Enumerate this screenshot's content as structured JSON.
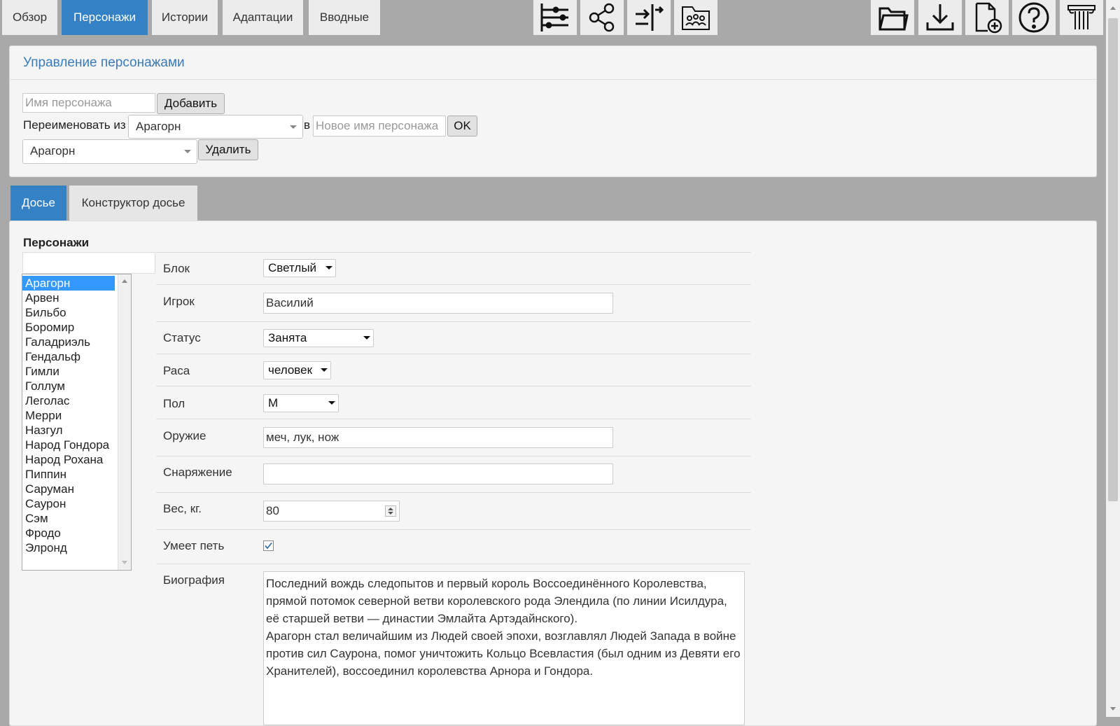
{
  "nav": {
    "tabs": [
      "Обзор",
      "Персонажи",
      "Истории",
      "Адаптации",
      "Вводные"
    ],
    "active_tab": "Персонажи",
    "icons": [
      "timeline-icon",
      "share-network-icon",
      "split-arrows-icon",
      "group-folder-icon",
      "open-folder-icon",
      "download-icon",
      "new-file-icon",
      "help-icon",
      "column-logo-icon"
    ]
  },
  "manage": {
    "title": "Управление персонажами",
    "name_placeholder": "Имя персонажа",
    "add_label": "Добавить",
    "rename_label": "Переименовать из",
    "rename_from": "Арагорн",
    "to_label": "в",
    "new_name_placeholder": "Новое имя персонажа",
    "ok_label": "OK",
    "delete_select": "Арагорн",
    "delete_label": "Удалить"
  },
  "subtabs": [
    "Досье",
    "Конструктор досье"
  ],
  "active_subtab": "Досье",
  "dossier": {
    "list_title": "Персонажи",
    "filter_value": "",
    "characters": [
      "Арагорн",
      "Арвен",
      "Бильбо",
      "Боромир",
      "Галадриэль",
      "Гендальф",
      "Гимли",
      "Голлум",
      "Леголас",
      "Мерри",
      "Назгул",
      "Народ Гондора",
      "Народ Рохана",
      "Пиппин",
      "Саруман",
      "Саурон",
      "Сэм",
      "Фродо",
      "Элронд"
    ],
    "selected_character": "Арагорн",
    "fields": {
      "block_label": "Блок",
      "block_value": "Светлый",
      "player_label": "Игрок",
      "player_value": "Василий",
      "status_label": "Статус",
      "status_value": "Занята",
      "race_label": "Раса",
      "race_value": "человек",
      "gender_label": "Пол",
      "gender_value": "М",
      "weapon_label": "Оружие",
      "weapon_value": "меч, лук, нож",
      "gear_label": "Снаряжение",
      "gear_value": "",
      "weight_label": "Вес, кг.",
      "weight_value": "80",
      "sing_label": "Умеет петь",
      "sing_checked": true,
      "bio_label": "Биография",
      "bio_p1": "Последний вождь следопытов и первый король Воссоединённого Королевства, прямой потомок северной ветви королевского рода Элендила (по линии Исилдура, её старшей ветви — династии Эмлайта Артэдайнского).",
      "bio_p2": "Арагорн стал величайшим из Людей своей эпохи, возглавлял Людей Запада в войне против сил Саурона, помог уничтожить Кольцо Всевластия (был одним из Девяти его Хранителей), воссоединил королевства Арнора и Гондора."
    }
  },
  "colors": {
    "accent": "#3581c5",
    "title": "#3a7bb8",
    "background": "#a9a9a9"
  }
}
